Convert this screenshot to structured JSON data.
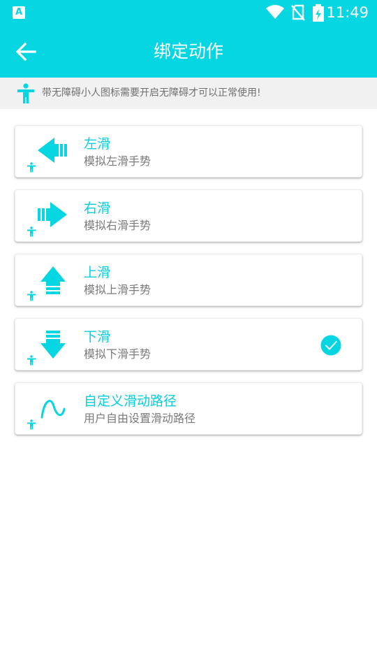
{
  "statusbar": {
    "time": "11:49",
    "left_icon": "A",
    "icons": [
      "wifi-icon",
      "no-sim-icon",
      "battery-charging-icon"
    ]
  },
  "appbar": {
    "title": "绑定动作",
    "back_icon": "arrow-back-icon"
  },
  "notice": {
    "text": "带无障碍小人图标需要开启无障碍才可以正常使用!",
    "icon": "accessibility-icon"
  },
  "colors": {
    "accent": "#05d6e2",
    "notice_bg": "#f1f1f1",
    "subtext": "#7a7a7a"
  },
  "actions": [
    {
      "title": "左滑",
      "subtitle": "模拟左滑手势",
      "icon": "swipe-left-icon",
      "selected": false
    },
    {
      "title": "右滑",
      "subtitle": "模拟右滑手势",
      "icon": "swipe-right-icon",
      "selected": false
    },
    {
      "title": "上滑",
      "subtitle": "模拟上滑手势",
      "icon": "swipe-up-icon",
      "selected": false
    },
    {
      "title": "下滑",
      "subtitle": "模拟下滑手势",
      "icon": "swipe-down-icon",
      "selected": true
    },
    {
      "title": "自定义滑动路径",
      "subtitle": "用户自由设置滑动路径",
      "icon": "custom-path-icon",
      "selected": false
    }
  ]
}
